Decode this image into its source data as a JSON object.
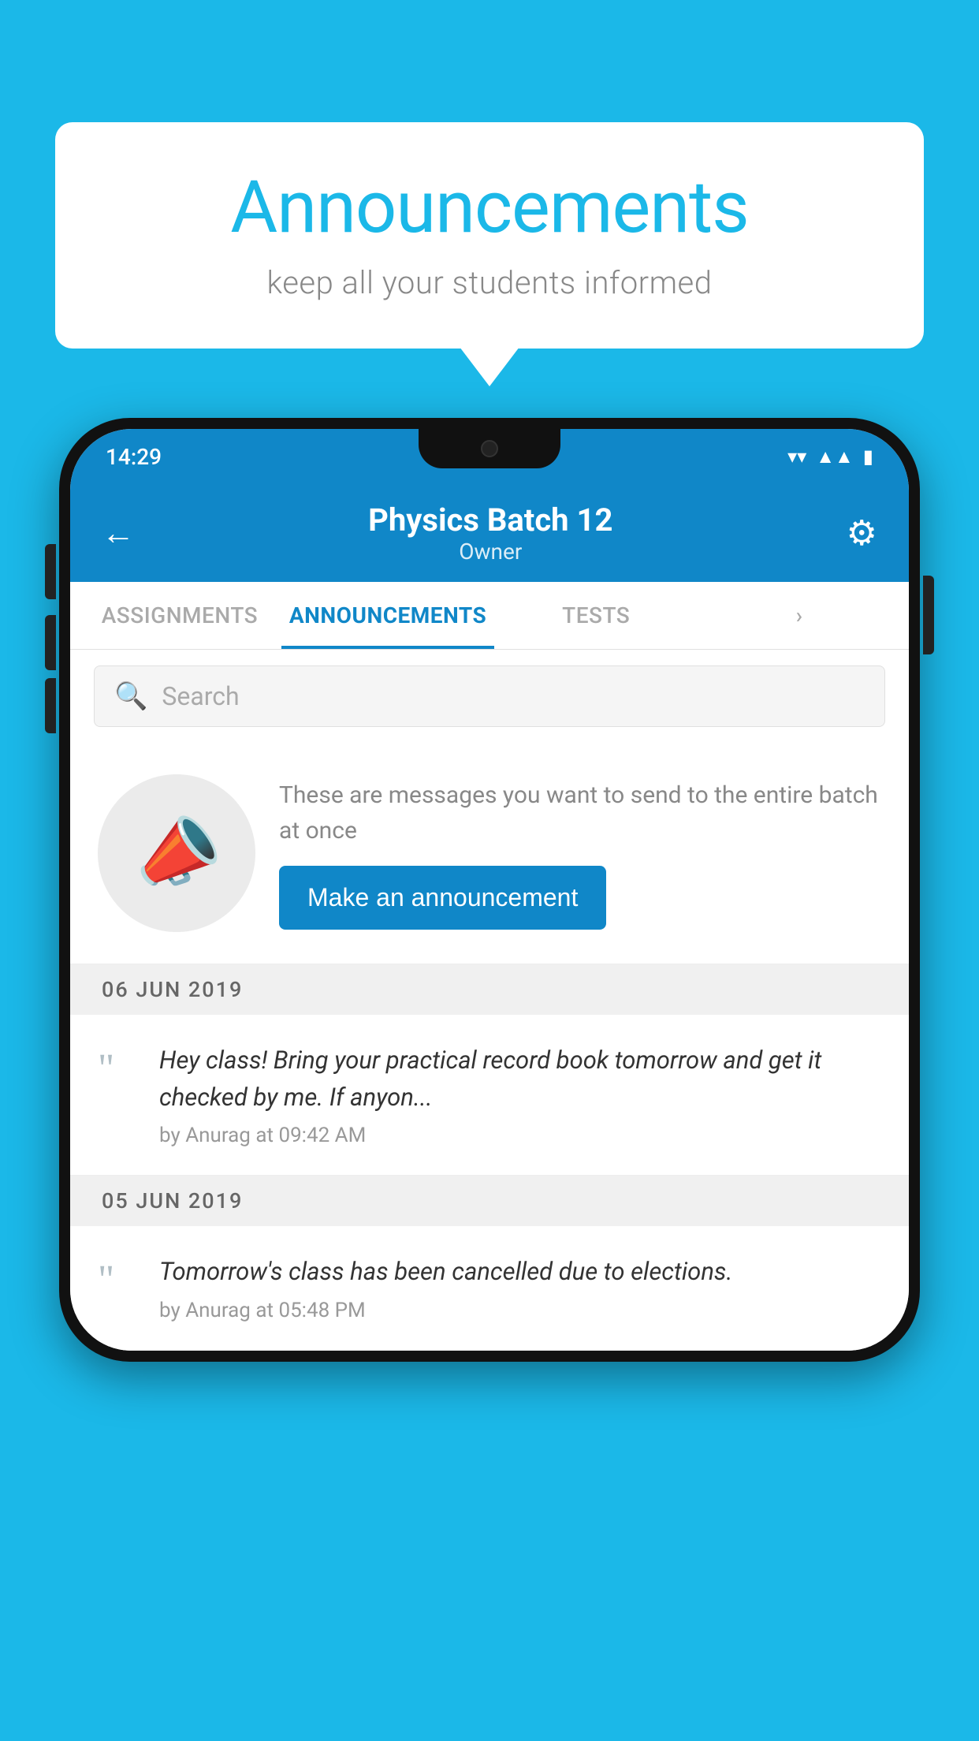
{
  "background_color": "#1BB8E8",
  "speech_bubble": {
    "title": "Announcements",
    "subtitle": "keep all your students informed"
  },
  "phone": {
    "status_bar": {
      "time": "14:29",
      "wifi_icon": "▲",
      "signal_icon": "▲",
      "battery_icon": "▮"
    },
    "header": {
      "back_icon": "←",
      "title": "Physics Batch 12",
      "subtitle": "Owner",
      "gear_icon": "⚙"
    },
    "tabs": [
      {
        "label": "ASSIGNMENTS",
        "active": false
      },
      {
        "label": "ANNOUNCEMENTS",
        "active": true
      },
      {
        "label": "TESTS",
        "active": false
      },
      {
        "label": "›",
        "active": false
      }
    ],
    "search": {
      "placeholder": "Search"
    },
    "announcement_prompt": {
      "description_text": "These are messages you want to send to the entire batch at once",
      "button_label": "Make an announcement"
    },
    "announcements": [
      {
        "date": "06  JUN  2019",
        "text": "Hey class! Bring your practical record book tomorrow and get it checked by me. If anyon...",
        "meta": "by Anurag at 09:42 AM"
      },
      {
        "date": "05  JUN  2019",
        "text": "Tomorrow's class has been cancelled due to elections.",
        "meta": "by Anurag at 05:48 PM"
      }
    ]
  }
}
